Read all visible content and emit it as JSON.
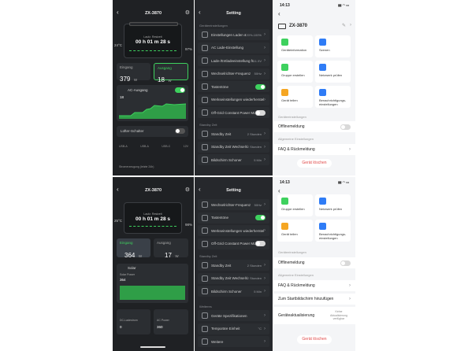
{
  "app": {
    "device_name": "ZX-3870"
  },
  "home": {
    "remaining_label": "Laufz. Restzeit",
    "remaining_time": "00 h 01 m 28 s",
    "remaining_time_b": "00 h 01 m 28 s",
    "temperature": "24°C",
    "battery_percent": "97%",
    "battery_percent_b": "98%",
    "temperature_b": "25°C",
    "input_label": "Eingang",
    "output_label": "Ausgang",
    "input_value": "379",
    "input_unit": "W",
    "output_value": "18",
    "output_unit": "W",
    "input_value_b": "364",
    "output_value_b": "17",
    "ac_output_label": "AC-Ausgang",
    "ac_output_value": "18",
    "solar_label": "Solar",
    "solar_power_label": "Solar Power",
    "solar_value": "364",
    "dc_label": "DC-Ladestrom",
    "dc_value": "0",
    "ac_power_label": "AC Power",
    "ac_power_value": "360",
    "fan_label": "Lüfter-Schalter",
    "usb_labels": [
      "USB-A",
      "USB-A",
      "USB-C",
      "12V"
    ],
    "small_label": "Stromerzeugung (letzte 24h)"
  },
  "settings": {
    "title": "Setting",
    "section_system": "Geräteeinstellungen",
    "rows_a": [
      {
        "label": "Einstellungen Laden & Entladen",
        "value": "20%-100%",
        "control": "chevron"
      },
      {
        "label": "AC Lade-Einstellung",
        "value": "",
        "control": "chevron"
      },
      {
        "label": "Lade-/Entladeeinstellung für Autos",
        "value": "11.5V",
        "control": "chevron"
      },
      {
        "label": "Wechselrichter-Frequenz",
        "value": "50Hz",
        "control": "chevron"
      },
      {
        "label": "Tastentöne",
        "value": "",
        "control": "on"
      },
      {
        "label": "Werkseinstellungen wiederherstellen",
        "value": "",
        "control": "chevron"
      },
      {
        "label": "Off-Grid Constant Power Mode",
        "value": "",
        "control": "off"
      }
    ],
    "section_standby": "Standby Zeit",
    "rows_standby": [
      {
        "label": "Standby Zeit",
        "value": "2 Stunden",
        "control": "chevron"
      },
      {
        "label": "Standby Zeit Wechselrichter",
        "value": "2 Stunden",
        "control": "chevron"
      },
      {
        "label": "Bildschirm Schoner",
        "value": "5 Min",
        "control": "chevron"
      }
    ],
    "section_more": "Weiteres",
    "rows_b": [
      {
        "label": "Wechselrichter-Frequenz",
        "value": "50Hz",
        "control": "chevron"
      },
      {
        "label": "Tastentöne",
        "value": "",
        "control": "on"
      },
      {
        "label": "Werkseinstellungen wiederherstellen",
        "value": "",
        "control": "chevron"
      },
      {
        "label": "Off-Grid Constant Power Mode",
        "value": "",
        "control": "off"
      }
    ],
    "rows_more": [
      {
        "label": "Geräte Spezifikationen",
        "value": "",
        "control": "chevron"
      },
      {
        "label": "Temporäre Einheit",
        "value": "°C",
        "control": "chevron"
      },
      {
        "label": "Weitere",
        "value": "",
        "control": "chevron"
      }
    ]
  },
  "profile": {
    "time": "14:13",
    "device_name": "ZX-3870",
    "tiles": [
      {
        "label": "Geräteinformation",
        "color": "#3ed15e"
      },
      {
        "label": "Szenen",
        "color": "#2f7cf6"
      },
      {
        "label": "Gruppe erstellen",
        "color": "#3ed15e"
      },
      {
        "label": "Netzwerk prüfen",
        "color": "#2f7cf6"
      },
      {
        "label": "Gerät teilen",
        "color": "#f5a623"
      },
      {
        "label": "Benachrichtigungs-einstellungen",
        "color": "#2f7cf6"
      }
    ],
    "section_device_offline": "Geräteeinstellungen",
    "offline_notice": "Offlinemeldung",
    "section_general": "Allgemeine Einstellungen",
    "faq": "FAQ & Rückmeldung",
    "add_home": "Zum Startbildschirm hinzufügen",
    "firmware": "Geräteaktualisierung",
    "firmware_status": "Keine Aktualisierung verfügbar",
    "remove": "Gerät löschen"
  }
}
